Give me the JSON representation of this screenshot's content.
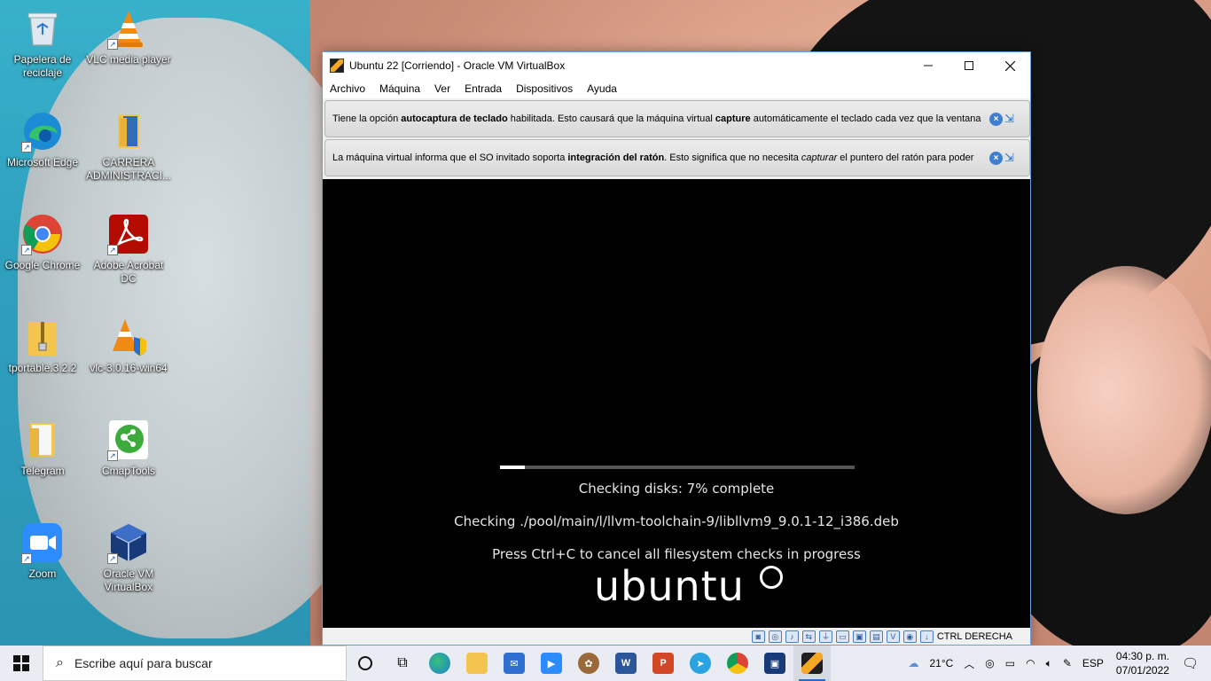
{
  "desktop": {
    "icons": [
      {
        "label": "Papelera de reciclaje",
        "icon": "recycle-bin-icon"
      },
      {
        "label": "VLC media player",
        "icon": "vlc-icon"
      },
      {
        "label": "Microsoft Edge",
        "icon": "edge-icon"
      },
      {
        "label": "CARRERA ADMINISTRACI...",
        "icon": "folder-icon"
      },
      {
        "label": "Google Chrome",
        "icon": "chrome-icon"
      },
      {
        "label": "Adobe Acrobat DC",
        "icon": "acrobat-icon"
      },
      {
        "label": "tportable.3.2.2",
        "icon": "zip-folder-icon"
      },
      {
        "label": "vlc-3.0.16-win64",
        "icon": "vlc-installer-icon"
      },
      {
        "label": "Telegram",
        "icon": "folder-icon"
      },
      {
        "label": "CmapTools",
        "icon": "cmaptools-icon"
      },
      {
        "label": "Zoom",
        "icon": "zoom-icon"
      },
      {
        "label": "Oracle VM VirtualBox",
        "icon": "virtualbox-icon"
      }
    ]
  },
  "window": {
    "title": "Ubuntu 22 [Corriendo] - Oracle VM VirtualBox",
    "menu": [
      "Archivo",
      "Máquina",
      "Ver",
      "Entrada",
      "Dispositivos",
      "Ayuda"
    ],
    "notice1": {
      "pre": "Tiene la opción ",
      "bold1": "autocaptura de teclado",
      "mid": " habilitada. Esto causará que la máquina virtual ",
      "bold2": "capture",
      "post": " automáticamente el teclado cada vez que la ventana"
    },
    "notice2": {
      "pre": "La máquina virtual informa que el SO invitado soporta ",
      "bold1": "integración del ratón",
      "mid": ". Esto significa que no necesita ",
      "italic": "capturar",
      "post": " el puntero del ratón para poder"
    },
    "vm": {
      "progress": 0.07,
      "line1": "Checking disks: 7% complete",
      "line2": "Checking ./pool/main/l/llvm-toolchain-9/libllvm9_9.0.1-12_i386.deb",
      "line3": "Press Ctrl+C to cancel all filesystem checks in progress",
      "logo": "ubuntu"
    },
    "statusbar": {
      "host_key": "CTRL DERECHA"
    }
  },
  "taskbar": {
    "search_placeholder": "Escribe aquí para buscar",
    "apps": [
      "cortana-icon",
      "task-view-icon",
      "edge-icon",
      "file-explorer-icon",
      "mail-icon",
      "zoom-icon",
      "gimp-icon",
      "word-icon",
      "powerpoint-icon",
      "telegram-icon",
      "chrome-icon",
      "virtualbox-icon",
      "virtualbox-vm-icon"
    ],
    "weather": "21°C",
    "language": "ESP",
    "time": "04:30 p. m.",
    "date": "07/01/2022"
  }
}
